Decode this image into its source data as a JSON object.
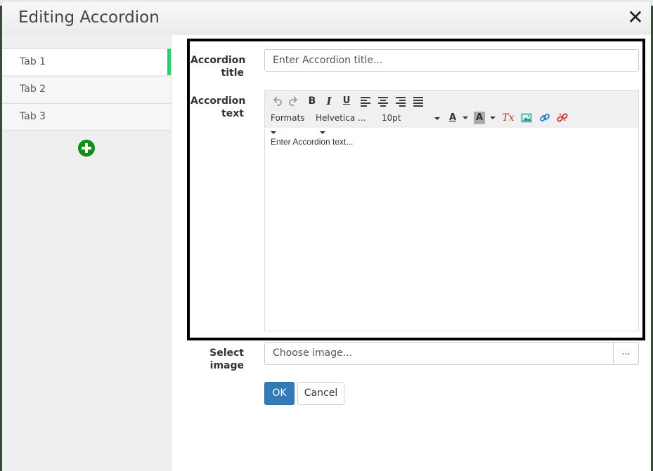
{
  "dialog": {
    "title": "Editing Accordion",
    "close_label": "✕"
  },
  "sidebar": {
    "tabs": [
      {
        "label": "Tab 1",
        "active": true
      },
      {
        "label": "Tab 2",
        "active": false
      },
      {
        "label": "Tab 3",
        "active": false
      }
    ],
    "add_icon": "plus-circle-icon"
  },
  "form": {
    "title_label_1": "Accordion",
    "title_label_2": "title",
    "title_placeholder": "Enter Accordion title...",
    "text_label_1": "Accordion",
    "text_label_2": "text",
    "image_label_1": "Select",
    "image_label_2": "image",
    "image_placeholder": "Choose image...",
    "browse_label": "..."
  },
  "editor": {
    "toolbar": {
      "bold": "B",
      "italic": "I",
      "underline": "U",
      "formats": "Formats",
      "font": "Helvetica ...",
      "size": "10pt",
      "text_color": "A",
      "bg_color": "A",
      "clear_format": "Tx"
    },
    "body_text": "Enter Accordion text..."
  },
  "buttons": {
    "ok": "OK",
    "cancel": "Cancel"
  },
  "colors": {
    "primary": "#337ab7",
    "active_tab_marker": "#2ecc71",
    "add_icon": "#118c1c"
  }
}
